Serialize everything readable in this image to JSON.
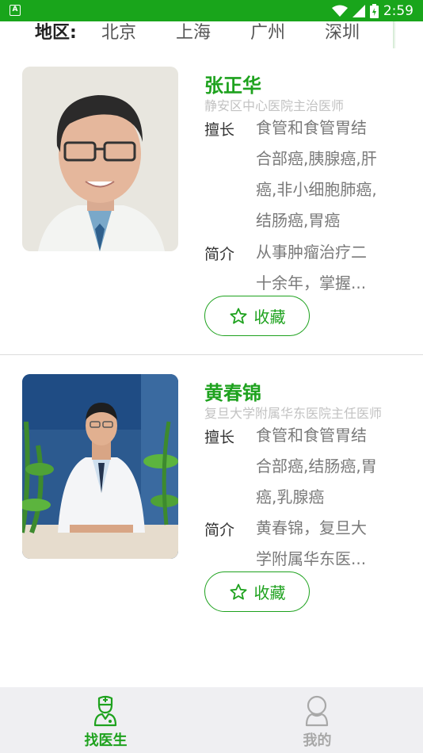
{
  "status_bar": {
    "time": "2:59",
    "app_badge": "A"
  },
  "region": {
    "label": "地区:",
    "cities": [
      "北京",
      "上海",
      "广州",
      "深圳"
    ]
  },
  "doctors": [
    {
      "name": "张正华",
      "hospital_title": "静安区中心医院主治医师",
      "specialty_label": "擅长",
      "specialty_lines": [
        "食管和食管胃结",
        "合部癌,胰腺癌,肝",
        "癌,非小细胞肺癌,",
        "结肠癌,胃癌"
      ],
      "intro_label": "简介",
      "intro_lines": [
        "从事肿瘤治疗二",
        "十余年，掌握..."
      ],
      "favorite_label": "收藏"
    },
    {
      "name": "黄春锦",
      "hospital_title": "复旦大学附属华东医院主任医师",
      "specialty_label": "擅长",
      "specialty_lines": [
        "食管和食管胃结",
        "合部癌,结肠癌,胃",
        "癌,乳腺癌"
      ],
      "intro_label": "简介",
      "intro_lines": [
        "黄春锦，复旦大",
        "学附属华东医..."
      ],
      "favorite_label": "收藏"
    }
  ],
  "tabs": [
    {
      "label": "找医生",
      "icon": "doctor-icon",
      "active": true
    },
    {
      "label": "我的",
      "icon": "profile-icon",
      "active": false
    }
  ],
  "colors": {
    "accent": "#1ea21e",
    "status_bar": "#19a51b",
    "tab_inactive": "#a8a8a8"
  }
}
